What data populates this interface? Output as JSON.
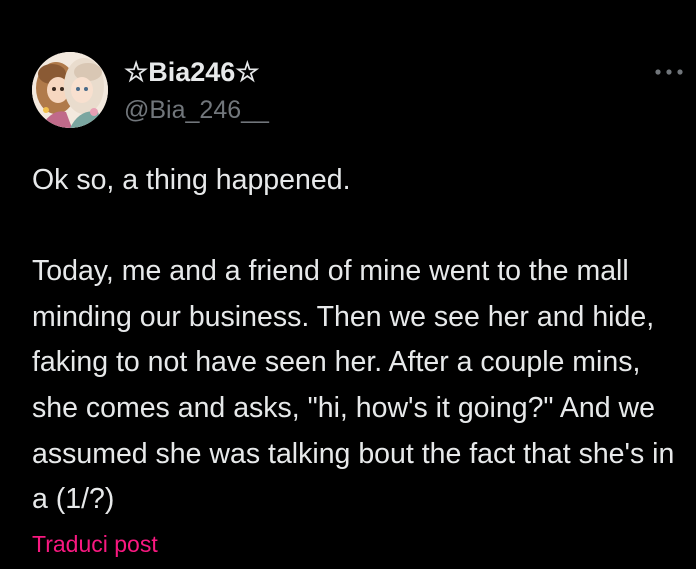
{
  "tweet": {
    "display_name": "☆Bia246☆",
    "handle": "@Bia_246__",
    "text": "Ok so, a thing happened.\n\nToday, me and a friend of mine went to the mall minding our business. Then we see her and hide, faking to not have seen her. After a couple mins, she comes and asks, \"hi, how's it going?\" And we assumed she was talking bout the fact that she's in a (1/?)",
    "translate_label": "Traduci post"
  },
  "icons": {
    "more": "more-horizontal-icon",
    "avatar": "profile-avatar"
  },
  "colors": {
    "background": "#000000",
    "text": "#e7e9ea",
    "secondary_text": "#71767b",
    "accent_link": "#f91880"
  }
}
